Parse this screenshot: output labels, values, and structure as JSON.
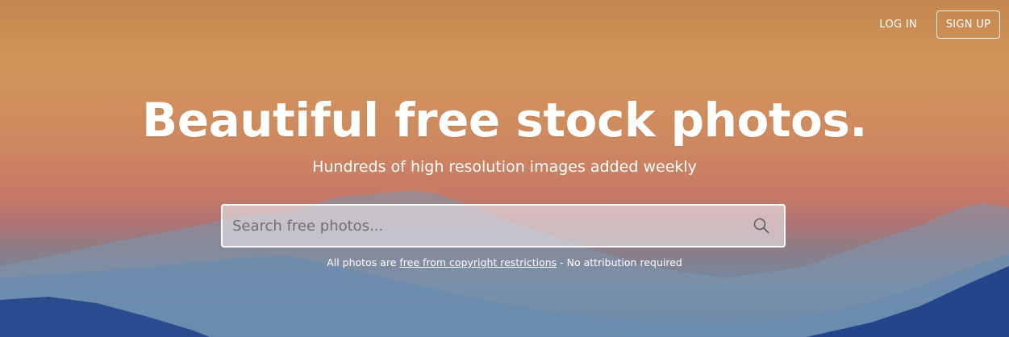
{
  "nav": {
    "login_label": "LOG IN",
    "signup_label": "SIGN UP"
  },
  "hero": {
    "headline": "Beautiful free stock photos.",
    "subheadline": "Hundreds of high resolution images added weekly"
  },
  "search": {
    "placeholder": "Search free photos...",
    "value": "",
    "icon": "search-icon"
  },
  "note": {
    "prefix": "All photos are ",
    "link_text": "free from copyright restrictions",
    "suffix": " - No attribution required"
  },
  "colors": {
    "text": "#ffffff",
    "sky_top": "#c4874f",
    "sky_mid": "#cf8a5f",
    "mountain_far": "#6f8fae",
    "mountain_near": "#23468a"
  }
}
